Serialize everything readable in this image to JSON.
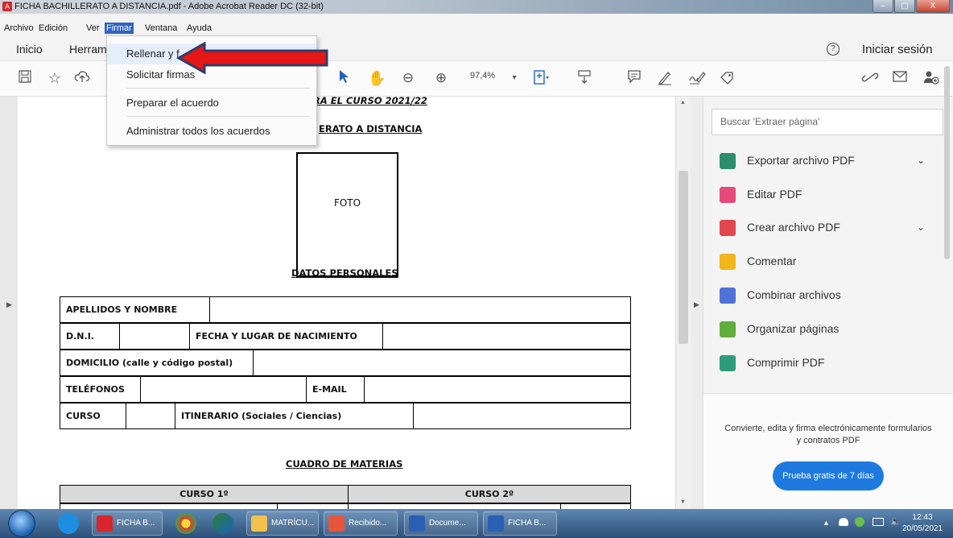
{
  "window": {
    "title": "FICHA BACHILLERATO A DISTANCIA.pdf - Adobe Acrobat Reader DC (32-bit)",
    "controls": [
      "–",
      "▢",
      "X"
    ]
  },
  "menubar": {
    "items": [
      "Archivo",
      "Edición",
      "Ver",
      "Firmar",
      "Ventana",
      "Ayuda"
    ],
    "active": "Firmar"
  },
  "tabs": {
    "home": "Inicio",
    "tools": "Herram",
    "help": "?",
    "signin": "Iniciar sesión"
  },
  "toolbar": {
    "zoom": "97,4%"
  },
  "dropdown": {
    "items": [
      "Rellenar y f",
      "Solicitar firmas",
      "Preparar el acuerdo",
      "Administrar todos los acuerdos"
    ],
    "highlighted": 0
  },
  "document": {
    "header_partial": "RA EL CURSO 2021/22",
    "subtitle_partial": "ERATO A DISTANCIA",
    "photo_label": "FOTO",
    "section_personal": "DATOS PERSONALES",
    "rows": {
      "name": "APELLIDOS Y NOMBRE",
      "dni": "D.N.I.",
      "birth": "FECHA Y LUGAR DE NACIMIENTO",
      "address": "DOMICILIO (calle y código postal)",
      "phones": "TELÉFONOS",
      "email": "E-MAIL",
      "course": "CURSO",
      "itinerary": "ITINERARIO (Sociales / Ciencias)"
    },
    "section_subjects": "CUADRO DE MATERIAS",
    "subjects_headers": [
      "CURSO 1º",
      "CURSO 2º"
    ]
  },
  "rightpanel": {
    "search_placeholder": "Buscar 'Extraer página'",
    "tools": [
      {
        "label": "Exportar archivo PDF",
        "color": "#2f8d6f",
        "chevron": "⌄"
      },
      {
        "label": "Editar PDF",
        "color": "#e54b7a",
        "chevron": ""
      },
      {
        "label": "Crear archivo PDF",
        "color": "#e2474d",
        "chevron": "⌄"
      },
      {
        "label": "Comentar",
        "color": "#f2b51c",
        "chevron": ""
      },
      {
        "label": "Combinar archivos",
        "color": "#4f72d9",
        "chevron": ""
      },
      {
        "label": "Organizar páginas",
        "color": "#5fae3b",
        "chevron": ""
      },
      {
        "label": "Comprimir PDF",
        "color": "#2e9c7a",
        "chevron": ""
      }
    ],
    "promo_text": "Convierte, edita y firma electrónicamente formularios y contratos PDF",
    "trial_button": "Prueba gratis de 7 días"
  },
  "taskbar": {
    "tasks": [
      {
        "label": "FICHA B...",
        "color": "#d8262c"
      },
      {
        "label": "MATRÍCU...",
        "color": "#f2c14e"
      },
      {
        "label": "Recibido...",
        "color": "#e5553c"
      },
      {
        "label": "Docume...",
        "color": "#2b5fb4"
      },
      {
        "label": "FICHA B...",
        "color": "#2b5fb4"
      }
    ],
    "time": "12:43",
    "date": "20/05/2021"
  }
}
